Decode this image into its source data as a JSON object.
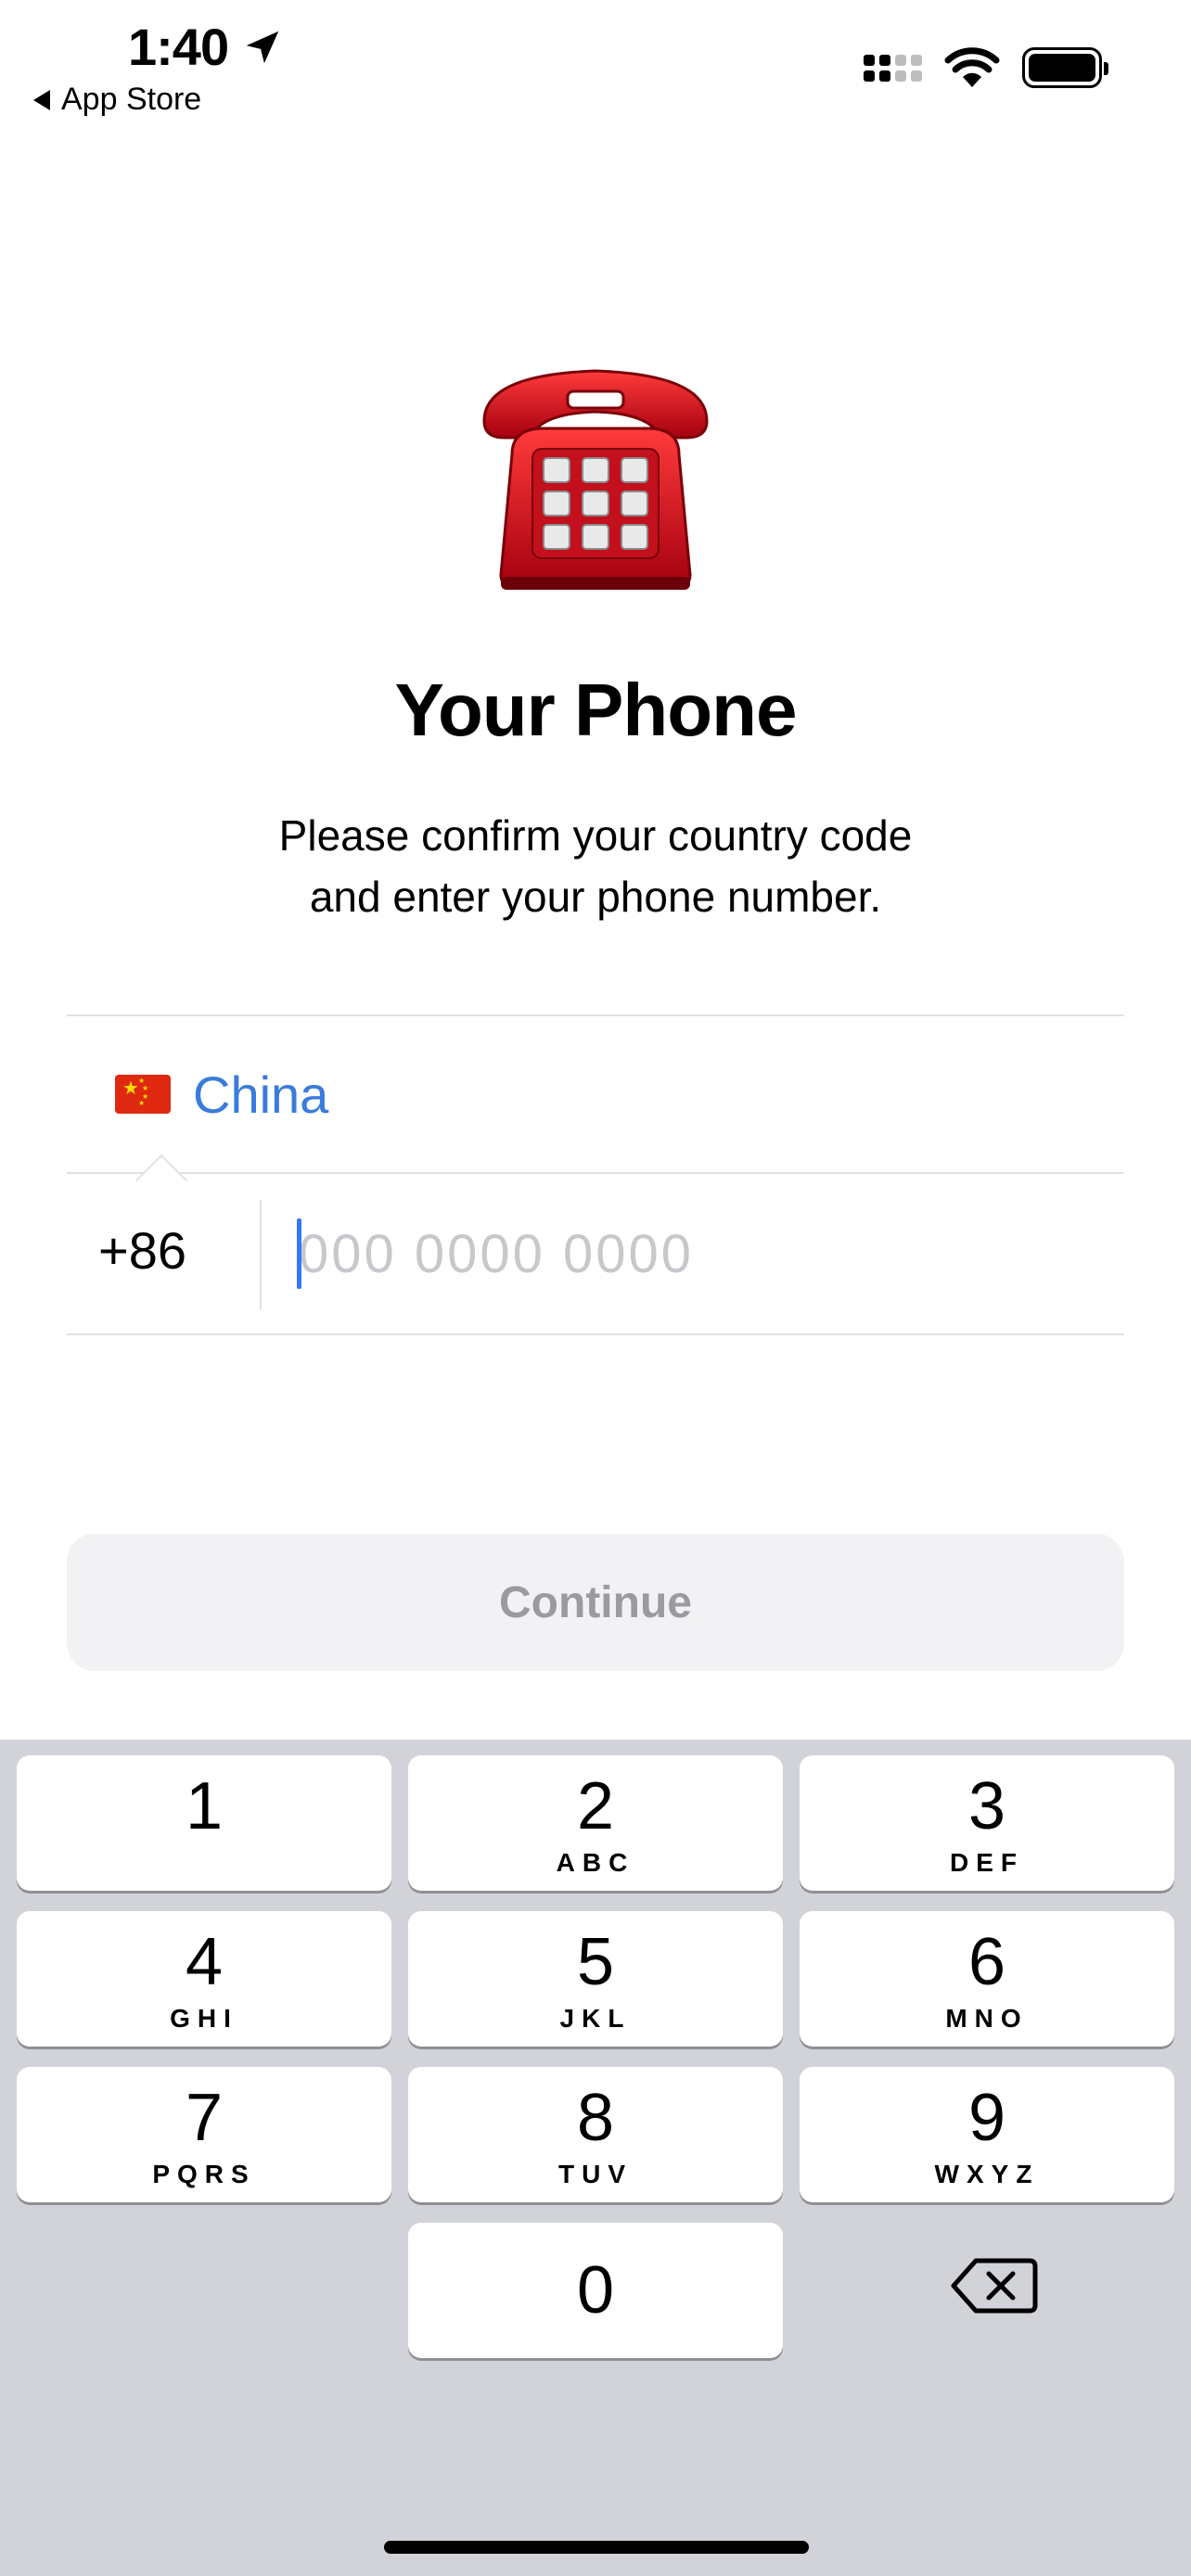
{
  "status_bar": {
    "time": "1:40",
    "back_label": "App Store",
    "location_icon": "location-arrow-icon",
    "signal_icon": "cellular-signal-icon",
    "wifi_icon": "wifi-icon",
    "battery_icon": "battery-icon"
  },
  "hero": {
    "icon": "telephone-icon",
    "title": "Your Phone",
    "subtitle_line1": "Please confirm your country code",
    "subtitle_line2": "and enter your phone number."
  },
  "form": {
    "country_flag": "china-flag-icon",
    "country_name": "China",
    "country_code": "+86",
    "phone_value": "",
    "phone_placeholder": "000 0000 0000"
  },
  "continue_label": "Continue",
  "keypad": {
    "keys": [
      {
        "num": "1",
        "letters": ""
      },
      {
        "num": "2",
        "letters": "ABC"
      },
      {
        "num": "3",
        "letters": "DEF"
      },
      {
        "num": "4",
        "letters": "GHI"
      },
      {
        "num": "5",
        "letters": "JKL"
      },
      {
        "num": "6",
        "letters": "MNO"
      },
      {
        "num": "7",
        "letters": "PQRS"
      },
      {
        "num": "8",
        "letters": "TUV"
      },
      {
        "num": "9",
        "letters": "WXYZ"
      },
      {
        "num": "0",
        "letters": ""
      }
    ],
    "delete_icon": "backspace-icon"
  },
  "colors": {
    "accent": "#3a7bdb",
    "caret": "#3478f6",
    "keyboard_bg": "#d1d3d9",
    "button_disabled_bg": "#f2f2f4",
    "button_disabled_text": "#9b9b9f",
    "phone_red": "#d8121c"
  }
}
